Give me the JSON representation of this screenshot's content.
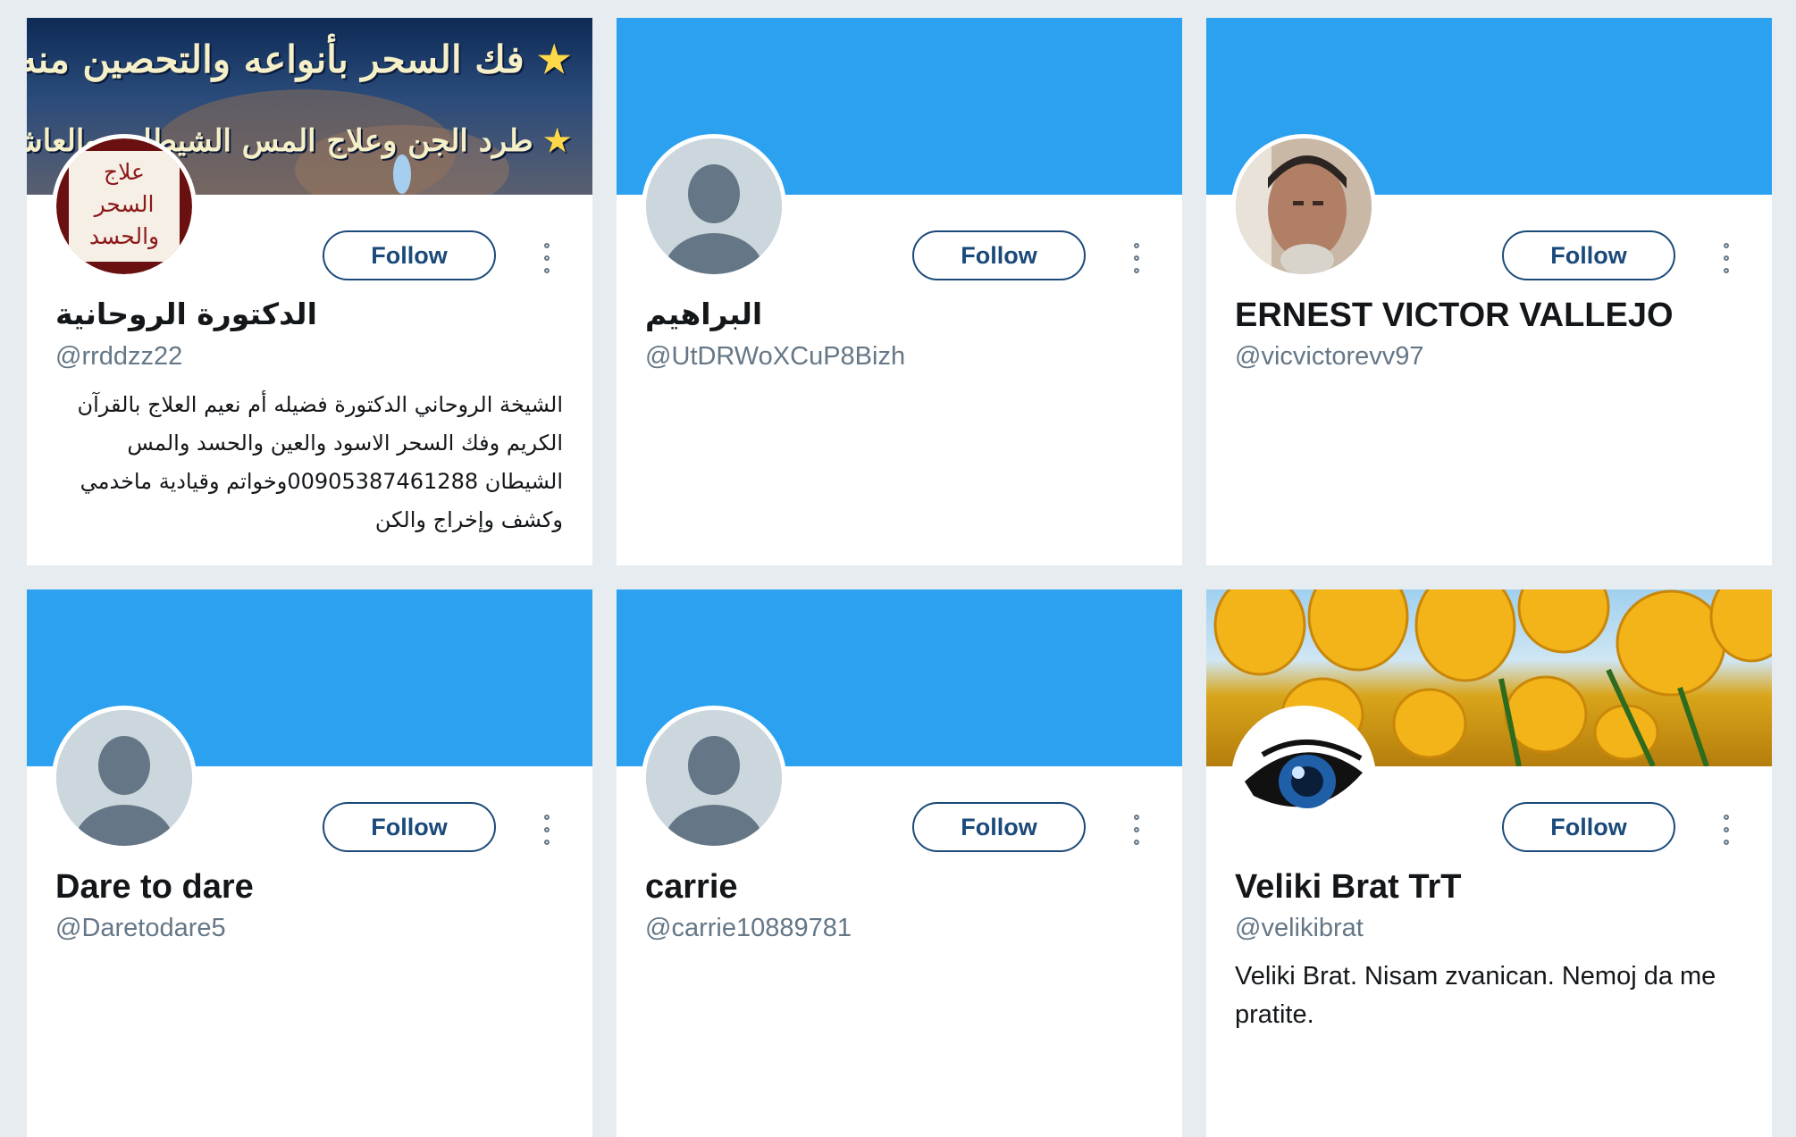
{
  "accent_color": "#2ba1ef",
  "button_color": "#1b4a7a",
  "cards": [
    {
      "name": "الدكتورة الروحانية",
      "handle": "@rrddzz22",
      "bio": "الشيخة الروحاني الدكتورة فضيله أم نعيم العلاج بالقرآن الكريم وفك السحر الاسود والعين والحسد والمس الشيطان 00905387461288وخواتم وقيادية ماخدمي وكشف وإخراج والكن",
      "follow_label": "Follow",
      "banner_line1": "فك السحر بأنواعه والتحصين منه",
      "banner_line2": "طرد الجن وعلاج المس الشيطاني والعاشق",
      "avatar_text": "علاج السحر والحسد",
      "avatar_icon": "logo-avatar"
    },
    {
      "name": "البراهيم",
      "handle": "@UtDRWoXCuP8Bizh",
      "bio": "",
      "follow_label": "Follow",
      "avatar_icon": "default-avatar-icon"
    },
    {
      "name": "ERNEST VICTOR VALLEJO",
      "handle": "@vicvictorevv97",
      "bio": "",
      "follow_label": "Follow",
      "avatar_icon": "photo-avatar"
    },
    {
      "name": "Dare to dare",
      "handle": "@Daretodare5",
      "bio": "",
      "follow_label": "Follow",
      "avatar_icon": "default-avatar-icon"
    },
    {
      "name": "carrie",
      "handle": "@carrie10889781",
      "bio": "",
      "follow_label": "Follow",
      "avatar_icon": "default-avatar-icon"
    },
    {
      "name": "Veliki Brat TrT",
      "handle": "@velikibrat",
      "bio": "Veliki Brat. Nisam zvanican. Nemoj da me pratite.",
      "follow_label": "Follow",
      "avatar_icon": "eye-icon"
    }
  ]
}
